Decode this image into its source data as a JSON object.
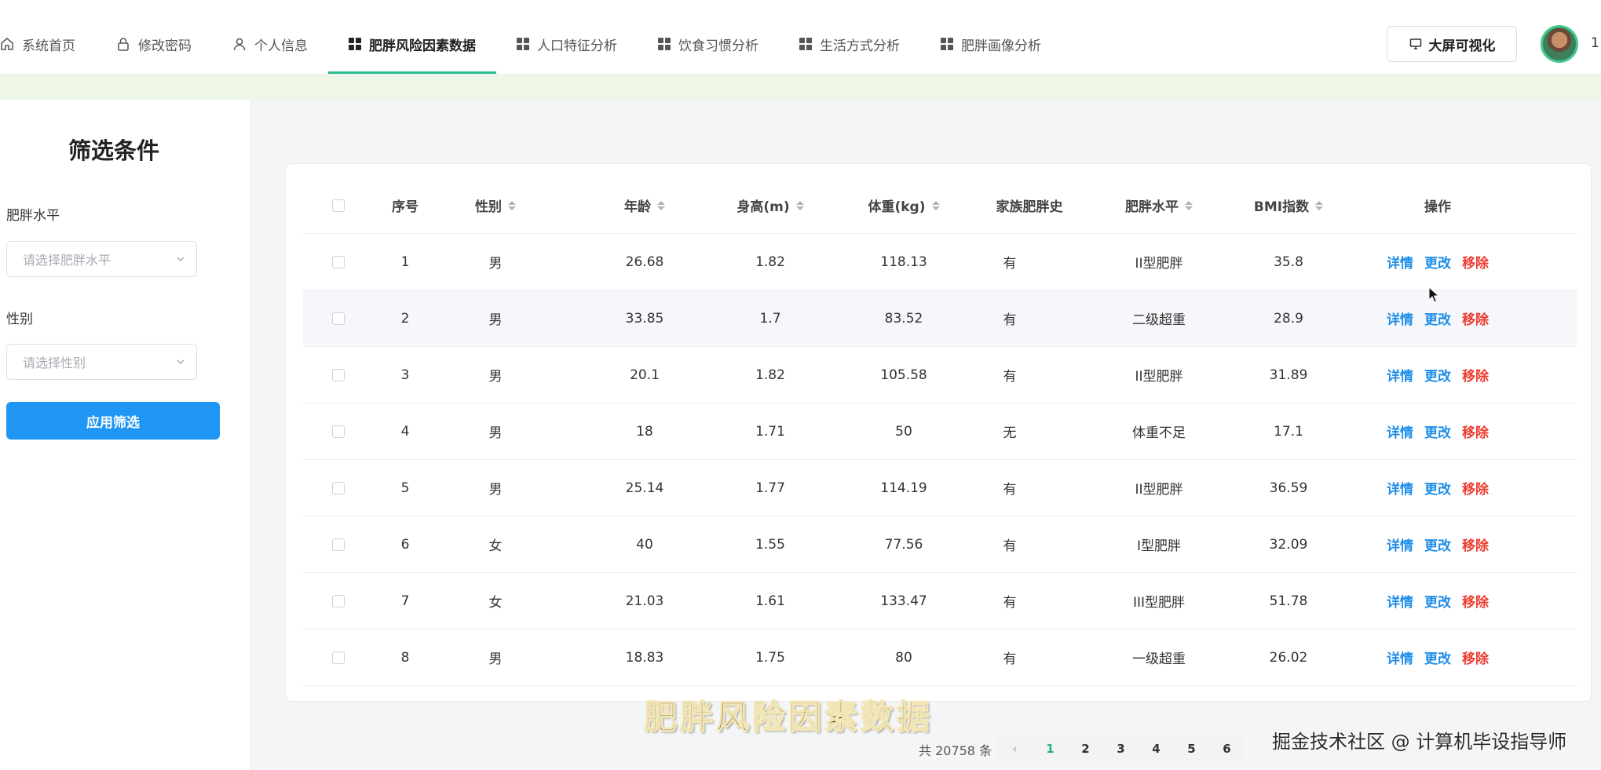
{
  "nav": {
    "items": [
      {
        "label": "系统首页",
        "icon": "home-icon"
      },
      {
        "label": "修改密码",
        "icon": "lock-icon"
      },
      {
        "label": "个人信息",
        "icon": "user-icon"
      },
      {
        "label": "肥胖风险因素数据",
        "icon": "grid-icon",
        "active": true
      },
      {
        "label": "人口特征分析",
        "icon": "grid-icon"
      },
      {
        "label": "饮食习惯分析",
        "icon": "grid-icon"
      },
      {
        "label": "生活方式分析",
        "icon": "grid-icon"
      },
      {
        "label": "肥胖画像分析",
        "icon": "grid-icon"
      }
    ],
    "screen_button": "大屏可视化",
    "user_label": "1"
  },
  "sidebar": {
    "title": "筛选条件",
    "obesity_label": "肥胖水平",
    "obesity_placeholder": "请选择肥胖水平",
    "gender_label": "性别",
    "gender_placeholder": "请选择性别",
    "apply_button": "应用筛选"
  },
  "table": {
    "headers": {
      "index": "序号",
      "gender": "性别",
      "age": "年龄",
      "height": "身高(m)",
      "weight": "体重(kg)",
      "family": "家族肥胖史",
      "level": "肥胖水平",
      "bmi": "BMI指数",
      "ops": "操作"
    },
    "actions": {
      "detail": "详情",
      "edit": "更改",
      "remove": "移除"
    },
    "rows": [
      {
        "index": "1",
        "gender": "男",
        "age": "26.68",
        "height": "1.82",
        "weight": "118.13",
        "family": "有",
        "level": "II型肥胖",
        "bmi": "35.8"
      },
      {
        "index": "2",
        "gender": "男",
        "age": "33.85",
        "height": "1.7",
        "weight": "83.52",
        "family": "有",
        "level": "二级超重",
        "bmi": "28.9"
      },
      {
        "index": "3",
        "gender": "男",
        "age": "20.1",
        "height": "1.82",
        "weight": "105.58",
        "family": "有",
        "level": "II型肥胖",
        "bmi": "31.89"
      },
      {
        "index": "4",
        "gender": "男",
        "age": "18",
        "height": "1.71",
        "weight": "50",
        "family": "无",
        "level": "体重不足",
        "bmi": "17.1"
      },
      {
        "index": "5",
        "gender": "男",
        "age": "25.14",
        "height": "1.77",
        "weight": "114.19",
        "family": "有",
        "level": "II型肥胖",
        "bmi": "36.59"
      },
      {
        "index": "6",
        "gender": "女",
        "age": "40",
        "height": "1.55",
        "weight": "77.56",
        "family": "有",
        "level": "I型肥胖",
        "bmi": "32.09"
      },
      {
        "index": "7",
        "gender": "女",
        "age": "21.03",
        "height": "1.61",
        "weight": "133.47",
        "family": "有",
        "level": "III型肥胖",
        "bmi": "51.78"
      },
      {
        "index": "8",
        "gender": "男",
        "age": "18.83",
        "height": "1.75",
        "weight": "80",
        "family": "有",
        "level": "一级超重",
        "bmi": "26.02"
      }
    ]
  },
  "pagination": {
    "total": "共 20758 条",
    "pages": [
      "1",
      "2",
      "3",
      "4",
      "5",
      "6"
    ],
    "current": "1"
  },
  "overlay": {
    "subtitle": "肥胖风险因素数据",
    "watermark": "掘金技术社区 @ 计算机毕设指导师"
  },
  "colors": {
    "accent_green": "#27c091",
    "primary_blue": "#1f96f3",
    "link_blue": "#1f8ee8",
    "danger_red": "#ee3b2f"
  }
}
